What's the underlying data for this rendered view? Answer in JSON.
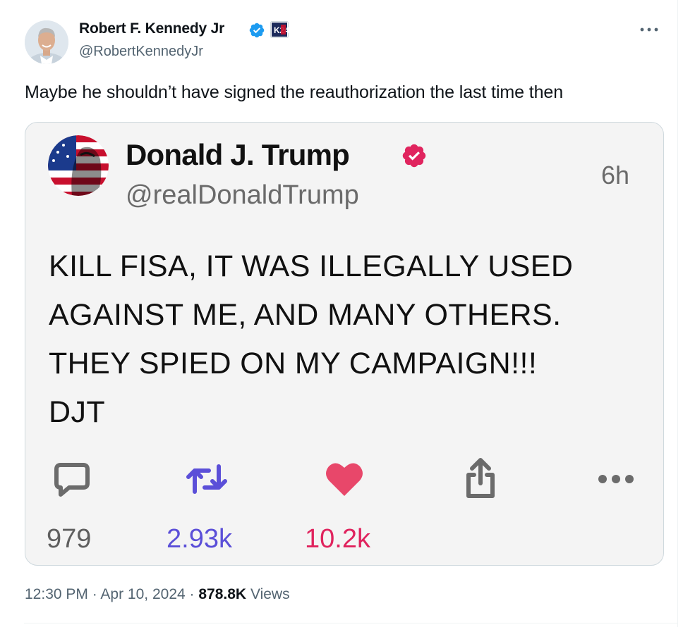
{
  "author": {
    "name": "Robert F. Kennedy Jr",
    "handle": "@RobertKennedyJr",
    "affiliation_badge": "K24"
  },
  "tweet": {
    "text": "Maybe he shouldn’t have signed the reauthorization the last time then"
  },
  "quoted": {
    "name": "Donald J. Trump",
    "handle": "@realDonaldTrump",
    "time": "6h",
    "body_lines": [
      "KILL FISA, IT WAS ILLEGALLY USED",
      "AGAINST ME, AND MANY OTHERS.",
      "THEY SPIED ON MY CAMPAIGN!!!",
      "DJT"
    ],
    "counts": {
      "replies": "979",
      "reposts": "2.93k",
      "likes": "10.2k"
    }
  },
  "meta": {
    "time": "12:30 PM",
    "separator": "·",
    "date": "Apr 10, 2024",
    "views_count": "878.8K",
    "views_label": "Views"
  },
  "icons": {
    "verified": "verified-badge-icon",
    "quoted_verified": "verified-badge-icon",
    "more": "more-horizontal-icon",
    "reply": "comment-icon",
    "repost": "repost-icon",
    "like": "heart-icon",
    "share": "share-icon"
  },
  "colors": {
    "blue_verified": "#1d9bf0",
    "pink_verified": "#e0245e",
    "repost": "#5b4fd8",
    "like": "#e0245e",
    "secondary_text": "#536471"
  }
}
